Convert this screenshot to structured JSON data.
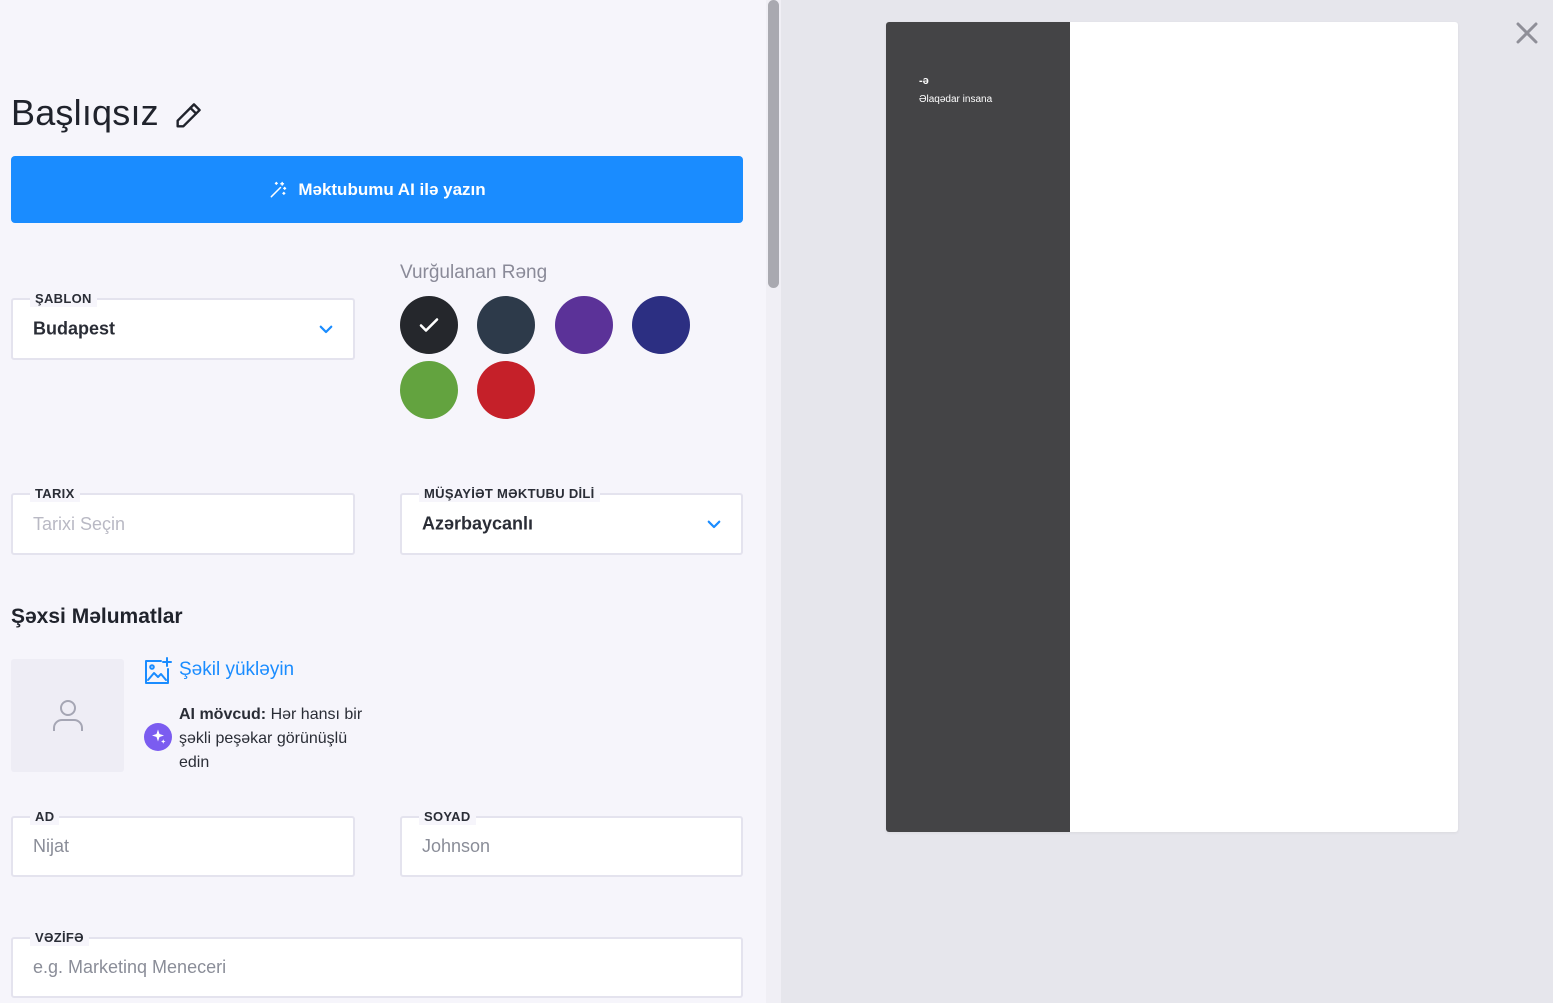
{
  "editor": {
    "title": "Başlıqsız",
    "ai_button_label": "Məktubumu AI ilə yazın",
    "template": {
      "label": "ŞABLON",
      "value": "Budapest"
    },
    "accent": {
      "label": "Vurğulanan Rəng",
      "colors": [
        "#25272c",
        "#2d3a4a",
        "#5b3298",
        "#2c2f82",
        "#63a33f",
        "#c52029"
      ],
      "selected_index": 0
    },
    "date": {
      "label": "TARIX",
      "placeholder": "Tarixi Seçin"
    },
    "language": {
      "label": "MÜŞAYİƏT MƏKTUBU DİLİ",
      "value": "Azərbaycanlı"
    },
    "personal_heading": "Şəxsi Məlumatlar",
    "photo": {
      "upload_label": "Şəkil yükləyin",
      "ai_note_bold": "AI mövcud:",
      "ai_note_text": "Hər hansı bir şəkli peşəkar görünüşlü edin"
    },
    "first_name": {
      "label": "AD",
      "placeholder": "Nijat"
    },
    "last_name": {
      "label": "SOYAD",
      "placeholder": "Johnson"
    },
    "job_title": {
      "label": "VƏZİFƏ",
      "placeholder": "e.g. Marketinq Meneceri"
    }
  },
  "preview": {
    "sidebar_color": "#444446",
    "initial": "-ə",
    "recipient": "Əlaqədar insana"
  }
}
